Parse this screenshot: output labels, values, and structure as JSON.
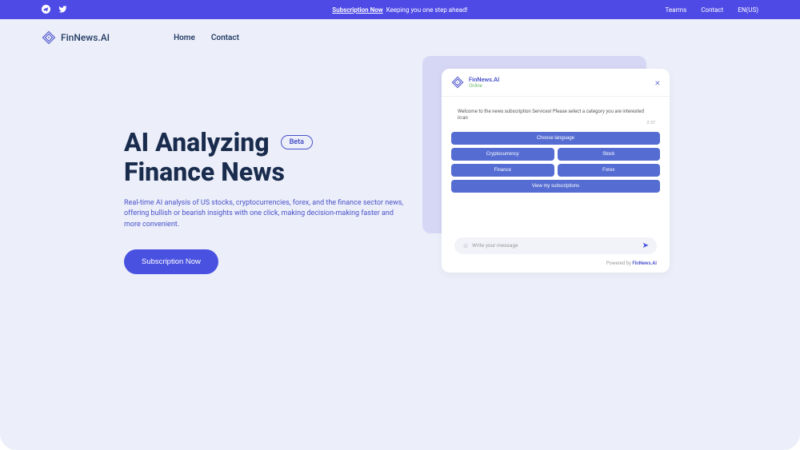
{
  "topbar": {
    "subscription_link": "Subscription Now",
    "subscription_text": "Keeping you one step ahead!",
    "links": {
      "terms": "Tearms",
      "contact": "Contact",
      "lang": "EN(US)"
    }
  },
  "nav": {
    "brand": "FinNews.AI",
    "links": {
      "home": "Home",
      "contact": "Contact"
    }
  },
  "hero": {
    "title1": "AI Analyzing",
    "title2": "Finance News",
    "beta": "Beta",
    "desc": "Real-time AI analysis of US stocks, cryptocurrencies, forex, and the finance sector news, offering bullish or bearish insights with one click, making decision-making faster and more convenient.",
    "cta": "Subscription Now"
  },
  "chat": {
    "brand": "FinNews.AI",
    "status": "Online",
    "welcome": "Welcome to the news subscription Services! Please select a category you are interested in:an",
    "time": "2:37",
    "buttons": {
      "lang": "Choose language",
      "crypto": "Cryptocurrency",
      "stock": "Stock",
      "finance": "Finance",
      "forex": "Forex",
      "subs": "View my subscriptions"
    },
    "input_placeholder": "Write your message",
    "powered_by": "Powered by",
    "powered_brand": "FinNews.AI"
  }
}
